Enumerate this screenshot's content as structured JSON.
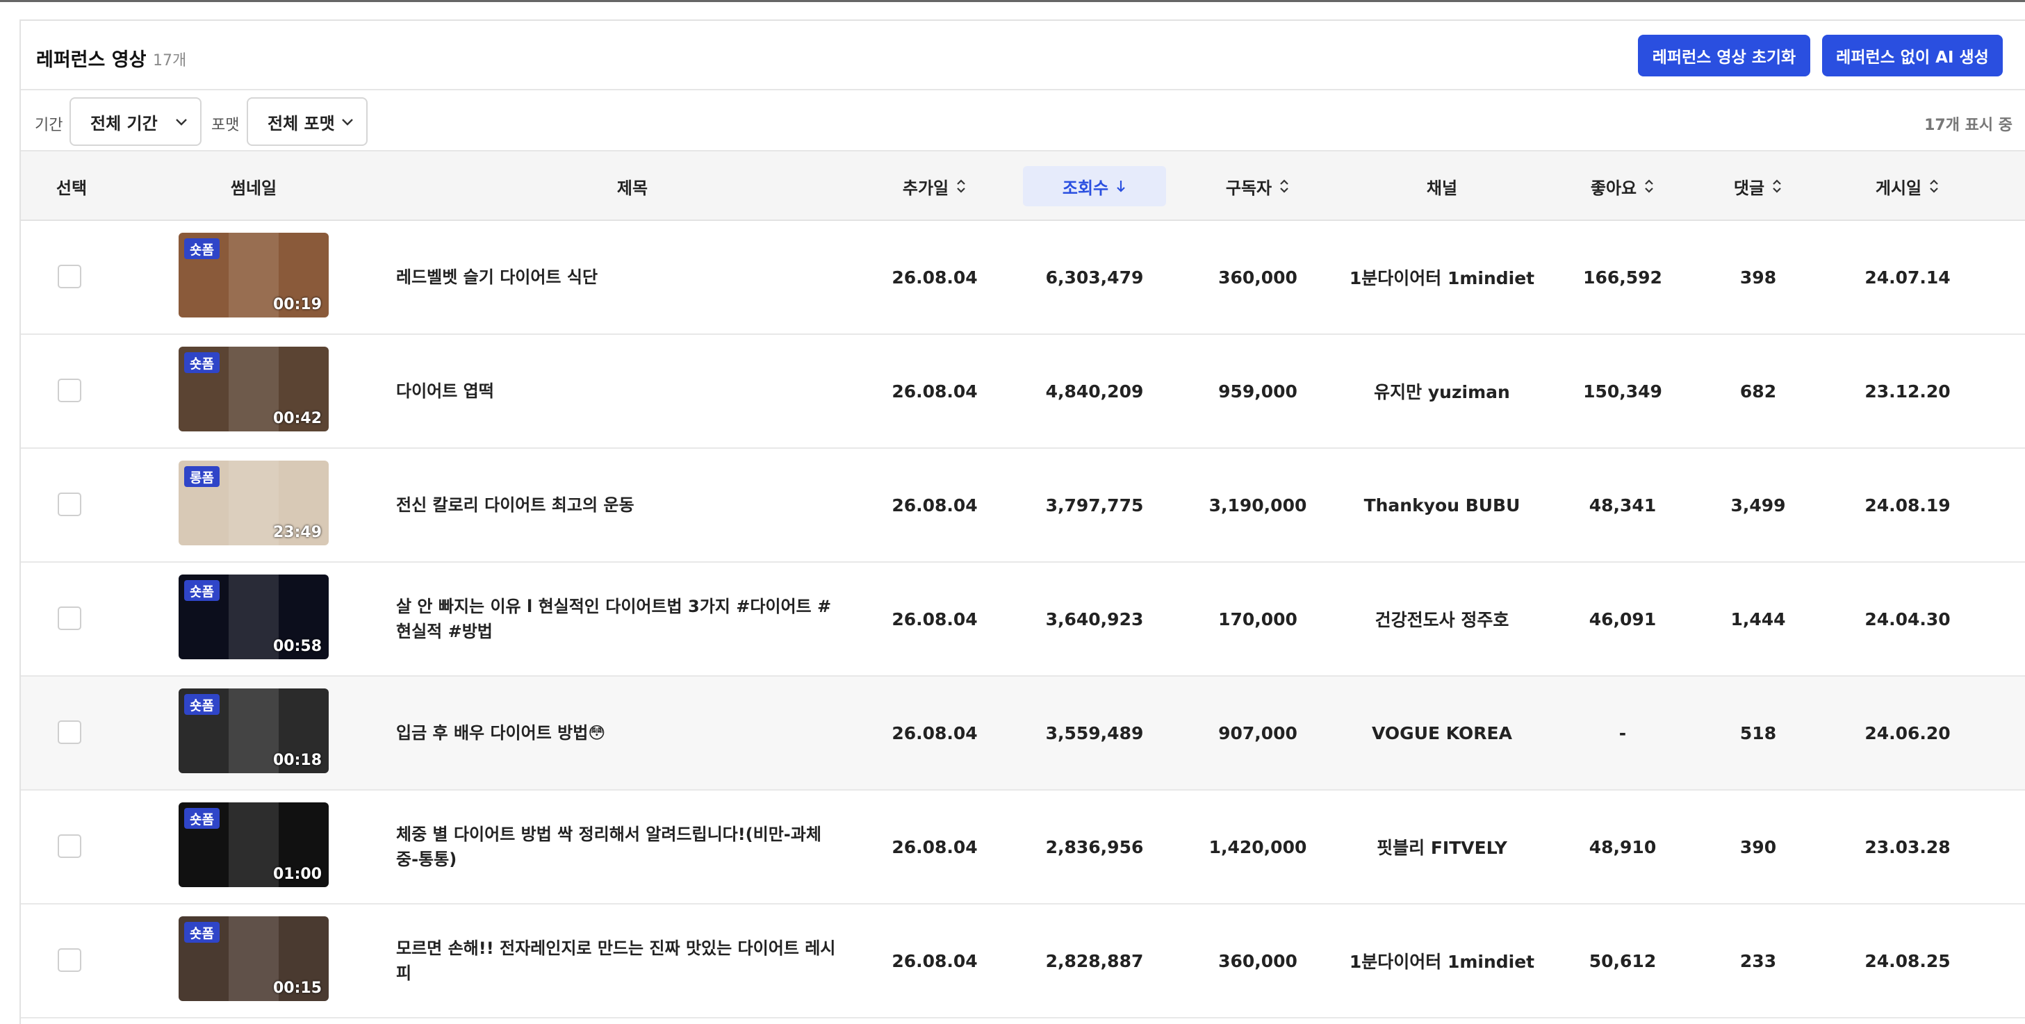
{
  "header": {
    "title": "레퍼런스 영상",
    "count": "17개",
    "reset_button": "레퍼런스 영상 초기화",
    "ai_button": "레퍼런스 없이 AI 생성"
  },
  "filters": {
    "period_label": "기간",
    "period_value": "전체 기간",
    "format_label": "포맷",
    "format_value": "전체 포맷",
    "showing": "17개 표시 중"
  },
  "columns": {
    "select": "선택",
    "thumbnail": "썸네일",
    "title": "제목",
    "added": "추가일",
    "views": "조회수",
    "subscribers": "구독자",
    "channel": "채널",
    "likes": "좋아요",
    "comments": "댓글",
    "published": "게시일"
  },
  "rows": [
    {
      "badge": "숏폼",
      "duration": "00:19",
      "title": "레드벨벳 슬기 다이어트 식단",
      "added": "26.08.04",
      "views": "6,303,479",
      "subscribers": "360,000",
      "channel": "1분다이어터 1mindiet",
      "likes": "166,592",
      "comments": "398",
      "published": "24.07.14",
      "thumb_color": "#8a5a3a"
    },
    {
      "badge": "숏폼",
      "duration": "00:42",
      "title": "다이어트 엽떡",
      "added": "26.08.04",
      "views": "4,840,209",
      "subscribers": "959,000",
      "channel": "유지만 yuziman",
      "likes": "150,349",
      "comments": "682",
      "published": "23.12.20",
      "thumb_color": "#5b4433"
    },
    {
      "badge": "롱폼",
      "duration": "23:49",
      "title": "전신 칼로리 다이어트 최고의 운동",
      "added": "26.08.04",
      "views": "3,797,775",
      "subscribers": "3,190,000",
      "channel": "Thankyou BUBU",
      "likes": "48,341",
      "comments": "3,499",
      "published": "24.08.19",
      "thumb_color": "#d8c9b6"
    },
    {
      "badge": "숏폼",
      "duration": "00:58",
      "title": "살 안 빠지는 이유 l 현실적인 다이어트법 3가지 #다이어트 #현실적 #방법",
      "added": "26.08.04",
      "views": "3,640,923",
      "subscribers": "170,000",
      "channel": "건강전도사 정주호",
      "likes": "46,091",
      "comments": "1,444",
      "published": "24.04.30",
      "thumb_color": "#0c0e1c"
    },
    {
      "badge": "숏폼",
      "duration": "00:18",
      "title": "입금 후 배우 다이어트 방법😳",
      "added": "26.08.04",
      "views": "3,559,489",
      "subscribers": "907,000",
      "channel": "VOGUE KOREA",
      "likes": "-",
      "comments": "518",
      "published": "24.06.20",
      "thumb_color": "#2b2b2b"
    },
    {
      "badge": "숏폼",
      "duration": "01:00",
      "title": "체중 별 다이어트 방법 싹 정리해서 알려드립니다!(비만-과체중-통통)",
      "added": "26.08.04",
      "views": "2,836,956",
      "subscribers": "1,420,000",
      "channel": "핏블리 FITVELY",
      "likes": "48,910",
      "comments": "390",
      "published": "23.03.28",
      "thumb_color": "#111111"
    },
    {
      "badge": "숏폼",
      "duration": "00:15",
      "title": "모르면 손해!! 전자레인지로 만드는 진짜 맛있는 다이어트 레시피",
      "added": "26.08.04",
      "views": "2,828,887",
      "subscribers": "360,000",
      "channel": "1분다이어터 1mindiet",
      "likes": "50,612",
      "comments": "233",
      "published": "24.08.25",
      "thumb_color": "#4a3a30"
    }
  ],
  "colors": {
    "accent": "#2a4fe0",
    "badge": "#2f45c8",
    "active_sort_bg": "#e6ebfb"
  },
  "icons": {
    "sort": "sort-updown-icon",
    "sort_desc": "arrow-down-icon",
    "select": "chevron-down-icon"
  }
}
